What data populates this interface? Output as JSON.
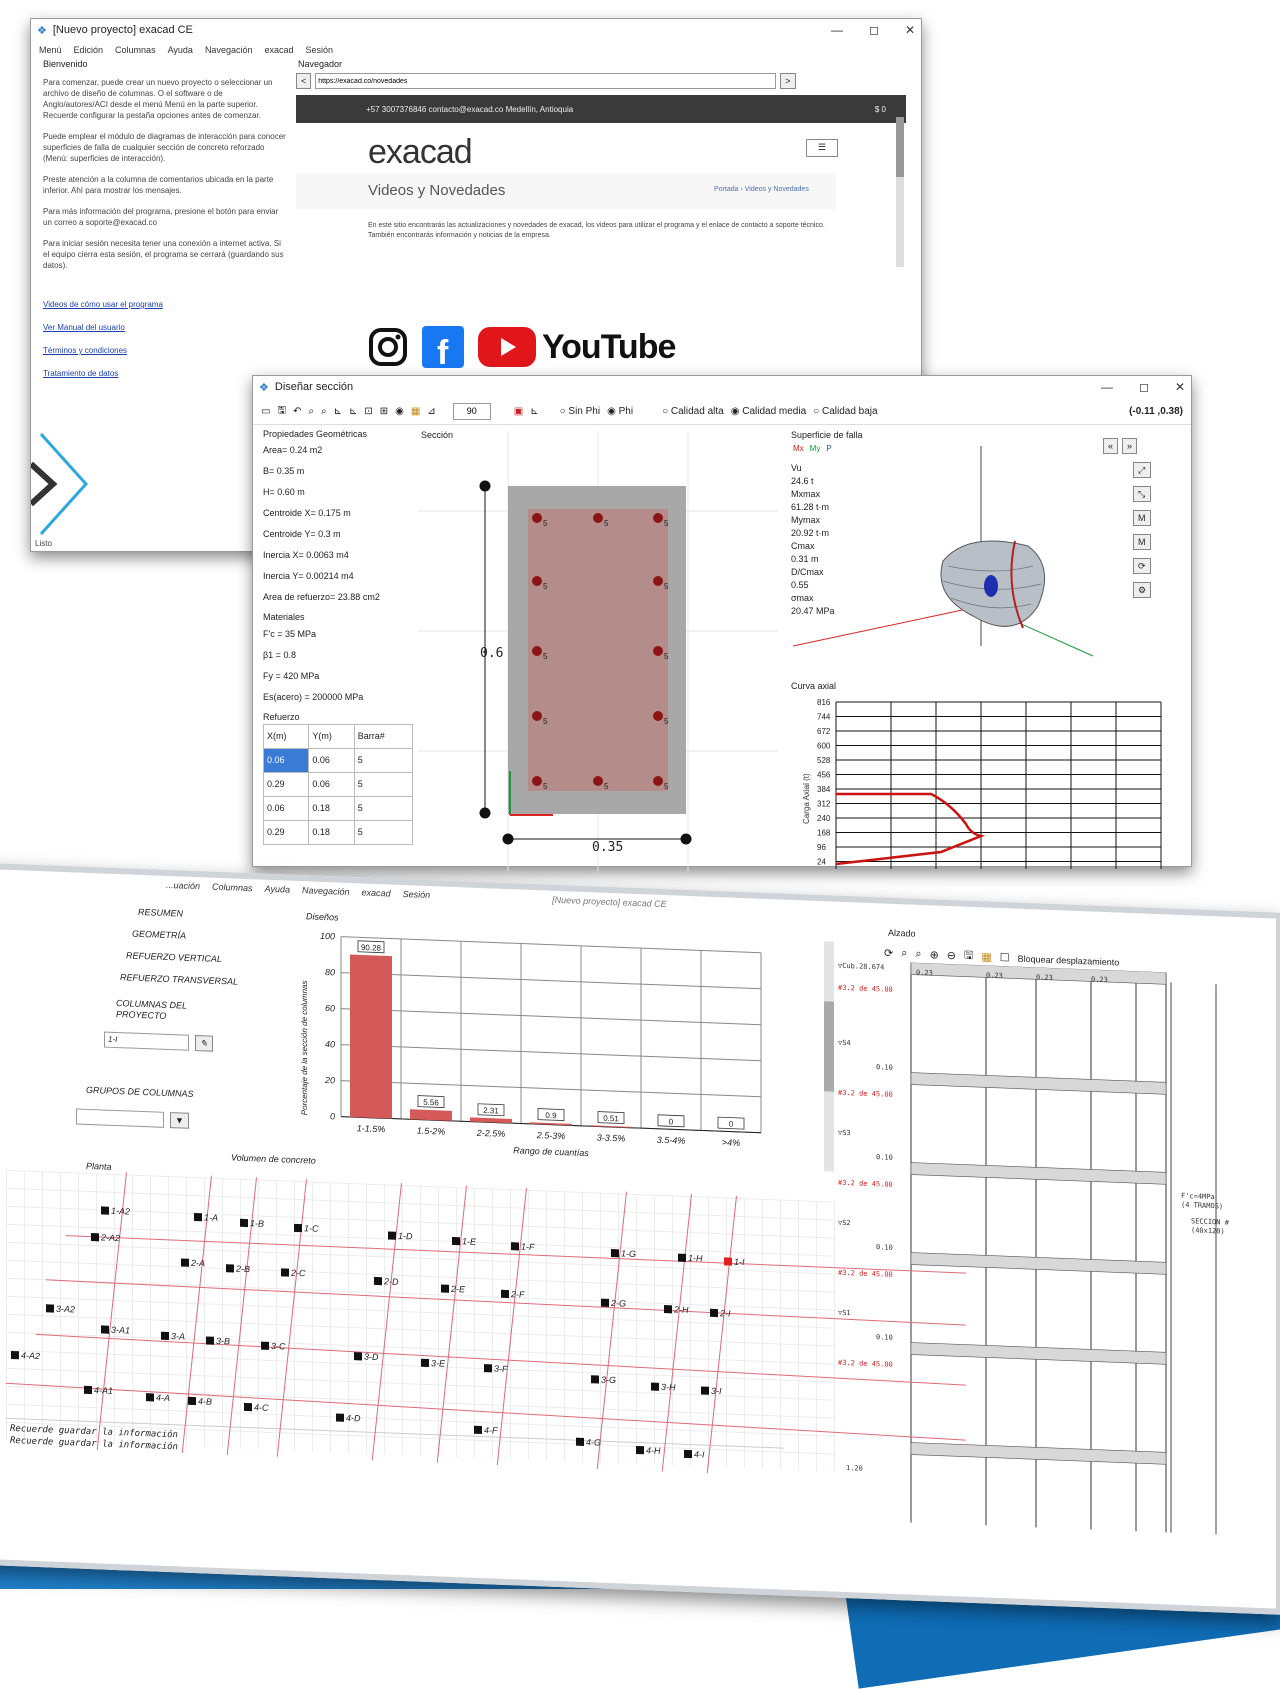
{
  "win1": {
    "title": "[Nuevo proyecto] exacad CE",
    "menu": [
      "Menú",
      "Edición",
      "Columnas",
      "Ayuda",
      "Navegación",
      "exacad",
      "Sesión"
    ],
    "left_heading": "Bienvenido",
    "paragraphs": [
      "Para comenzar, puede crear un nuevo proyecto o seleccionar un archivo de diseño de columnas. O el software o de Anglo/autores/ACI desde el menú Menú en la parte superior. Recuerde configurar la pestaña opciones antes de comenzar.",
      "Puede emplear el módulo de diagramas de interacción para conocer superficies de falla de cualquier sección de concreto reforzado (Menú: superficies de interacción).",
      "Preste atención a la columna de comentarios ubicada en la parte inferior. Ahí para mostrar los mensajes.",
      "Para más información del programa, presione el botón para enviar un correo a soporte@exacad.co",
      "Para iniciar sesión necesita tener una conexión a internet activa. Si el equipo cierra esta sesión, el programa se cerrará (guardando sus datos)."
    ],
    "links": [
      "Videos de cómo usar el programa",
      "Ver Manual del usuario",
      "Términos y condiciones",
      "Tratamiento de datos"
    ],
    "nav_label": "Navegador",
    "url": "https://exacad.co/novedades",
    "topbar": "+57 3007376846    contacto@exacad.co    Medellín, Antioquia",
    "topbar_right": "$ 0",
    "brand": "exacad",
    "hero_title": "Videos y Novedades",
    "breadcrumb": "Portada › Videos y Novedades",
    "body_text": "En este sitio encontrarás las actualizaciones y novedades de exacad, los videos para utilizar el programa y el enlace de contacto a soporte técnico. También encontrarás información y noticias de la empresa.",
    "youtube": "YouTube",
    "status": "Listo"
  },
  "win2": {
    "title": "Diseñar sección",
    "toolbar_value": "90",
    "radio_group1": [
      "Sin Phi",
      "Phi"
    ],
    "radio_group2": [
      "Calidad alta",
      "Calidad media",
      "Calidad baja"
    ],
    "coords": "(-0.11 ,0.38)",
    "props_title": "Propiedades Geométricas",
    "props": [
      "Area= 0.24 m2",
      "B= 0.35 m",
      "H= 0.60 m",
      "Centroide X= 0.175 m",
      "Centroide Y= 0.3 m",
      "Inercia X= 0.0063 m4",
      "Inercia Y= 0.00214 m4",
      "Area de refuerzo= 23.88 cm2"
    ],
    "mat_title": "Materiales",
    "mats": [
      "F'c = 35 MPa",
      "β1 = 0.8",
      "Fy = 420 MPa",
      "Es(acero) = 200000 MPa"
    ],
    "reb_title": "Refuerzo",
    "reb_headers": [
      "X(m)",
      "Y(m)",
      "Barra#"
    ],
    "reb_rows": [
      [
        "0.06",
        "0.06",
        "5"
      ],
      [
        "0.29",
        "0.06",
        "5"
      ],
      [
        "0.06",
        "0.18",
        "5"
      ],
      [
        "0.29",
        "0.18",
        "5"
      ]
    ],
    "section_label": "Sección",
    "dim_h": "0.6",
    "dim_b": "0.35",
    "bar_label": "5",
    "surface_label": "Superficie de falla",
    "surface_legend": [
      "Mx",
      "My",
      "P"
    ],
    "readouts": [
      "Vu",
      "24.6 t",
      "Mxmax",
      "61.28 t·m",
      "Mymax",
      "20.92 t·m",
      "Cmax",
      "0.31 m",
      "D/Cmax",
      "0.55",
      "σmax",
      "20.47 MPa"
    ],
    "axial_title": "Curva axial",
    "axial_ylabel": "Carga Axial (t)",
    "axial_ticks": [
      "816",
      "744",
      "672",
      "600",
      "528",
      "456",
      "384",
      "312",
      "240",
      "168",
      "96",
      "24"
    ]
  },
  "win3": {
    "menu": [
      "...uación",
      "Columnas",
      "Ayuda",
      "Navegación",
      "exacad",
      "Sesión"
    ],
    "center_title": "[Nuevo proyecto] exacad CE",
    "sidebar": [
      "RESUMEN",
      "GEOMETRÍA",
      "REFUERZO VERTICAL",
      "REFUERZO TRANSVERSAL",
      "COLUMNAS DEL PROYECTO",
      "GRUPOS DE COLUMNAS"
    ],
    "select_value": "1-I",
    "chart_title": "Diseños",
    "vol_label": "Volumen de concreto",
    "plan_label": "Planta",
    "elev_label": "Alzado",
    "lock_label": "Bloquear desplazamiento",
    "columns": [
      {
        "id": "1-A2",
        "x": 95,
        "y": 1195
      },
      {
        "id": "1-A",
        "x": 188,
        "y": 1198
      },
      {
        "id": "1-B",
        "x": 234,
        "y": 1202
      },
      {
        "id": "1-C",
        "x": 288,
        "y": 1205
      },
      {
        "id": "1-D",
        "x": 382,
        "y": 1209
      },
      {
        "id": "1-E",
        "x": 446,
        "y": 1212
      },
      {
        "id": "1-F",
        "x": 505,
        "y": 1215
      },
      {
        "id": "1-G",
        "x": 605,
        "y": 1218
      },
      {
        "id": "1-H",
        "x": 672,
        "y": 1220
      },
      {
        "id": "1-I",
        "x": 718,
        "y": 1222,
        "selected": true
      },
      {
        "id": "2-A2",
        "x": 85,
        "y": 1222
      },
      {
        "id": "2-A",
        "x": 175,
        "y": 1244
      },
      {
        "id": "2-B",
        "x": 220,
        "y": 1248
      },
      {
        "id": "2-C",
        "x": 275,
        "y": 1250
      },
      {
        "id": "2-D",
        "x": 368,
        "y": 1255
      },
      {
        "id": "2-E",
        "x": 435,
        "y": 1260
      },
      {
        "id": "2-F",
        "x": 495,
        "y": 1263
      },
      {
        "id": "2-G",
        "x": 595,
        "y": 1268
      },
      {
        "id": "2-H",
        "x": 658,
        "y": 1272
      },
      {
        "id": "2-I",
        "x": 704,
        "y": 1274
      },
      {
        "id": "3-A2",
        "x": 40,
        "y": 1295
      },
      {
        "id": "3-A1",
        "x": 95,
        "y": 1314
      },
      {
        "id": "3-A",
        "x": 155,
        "y": 1318
      },
      {
        "id": "3-B",
        "x": 200,
        "y": 1321
      },
      {
        "id": "3-C",
        "x": 255,
        "y": 1324
      },
      {
        "id": "3-D",
        "x": 348,
        "y": 1331
      },
      {
        "id": "3-E",
        "x": 415,
        "y": 1335
      },
      {
        "id": "3-F",
        "x": 478,
        "y": 1338
      },
      {
        "id": "3-G",
        "x": 585,
        "y": 1345
      },
      {
        "id": "3-H",
        "x": 645,
        "y": 1350
      },
      {
        "id": "3-I",
        "x": 695,
        "y": 1352
      },
      {
        "id": "4-A2",
        "x": 5,
        "y": 1343
      },
      {
        "id": "4-A1",
        "x": 78,
        "y": 1375
      },
      {
        "id": "4-A",
        "x": 140,
        "y": 1380
      },
      {
        "id": "4-B",
        "x": 182,
        "y": 1382
      },
      {
        "id": "4-C",
        "x": 238,
        "y": 1386
      },
      {
        "id": "4-D",
        "x": 330,
        "y": 1393
      },
      {
        "id": "4-F",
        "x": 468,
        "y": 1400
      },
      {
        "id": "4-G",
        "x": 570,
        "y": 1408
      },
      {
        "id": "4-H",
        "x": 630,
        "y": 1414
      },
      {
        "id": "4-I",
        "x": 678,
        "y": 1416
      }
    ],
    "log": [
      "Recuerde guardar la información",
      "Recuerde guardar la información"
    ],
    "elev_texts": [
      "▽Cub.28.674",
      "0.10",
      "0.23",
      "#3.2 de 45.00",
      "▽S4",
      "▽S3",
      "▽S2",
      "▽S1",
      "1.20",
      "SECCION #\n(40x120)",
      "F'c=4MPa\n(4 TRAMOS)"
    ]
  },
  "chart_data": {
    "type": "bar",
    "title": "Diseños",
    "xlabel": "Rango de cuantías",
    "ylabel": "Porcentaje de la sección de columnas",
    "categories": [
      "1-1.5%",
      "1.5-2%",
      "2-2.5%",
      "2.5-3%",
      "3-3.5%",
      "3.5-4%",
      ">4%"
    ],
    "values": [
      90.28,
      5.56,
      2.31,
      0.9,
      0.51,
      0,
      0
    ],
    "value_labels": [
      "90.28",
      "5.56",
      "2.31",
      "0.9",
      "0.51",
      "0",
      "0"
    ],
    "ylim": [
      0,
      100
    ],
    "yticks": [
      0,
      20,
      40,
      60,
      80,
      100
    ],
    "bar_color": "#d45a5a",
    "grid": true
  }
}
